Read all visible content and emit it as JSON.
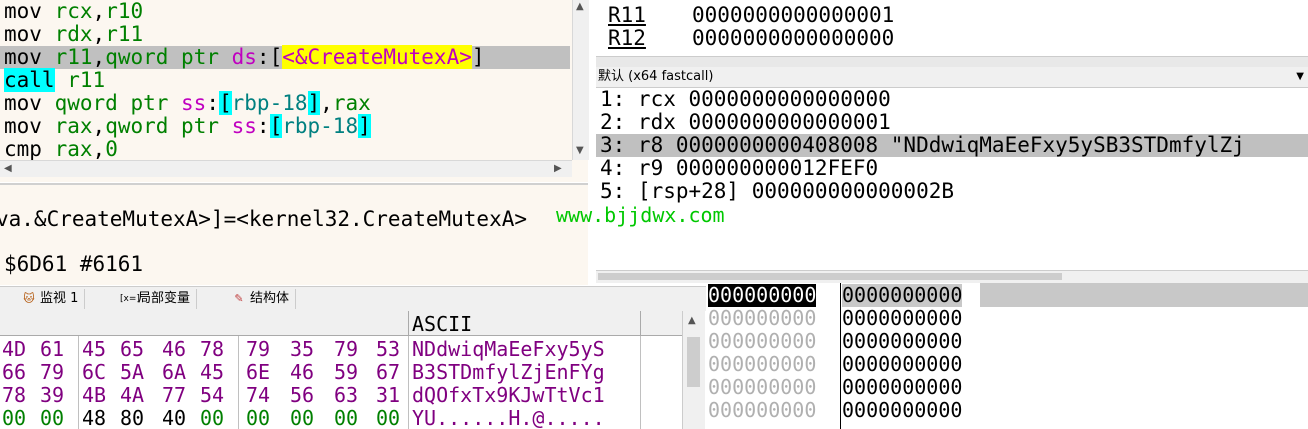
{
  "disassembly": {
    "lines": [
      {
        "op": "mov",
        "args": [
          {
            "t": "reg",
            "v": "rcx"
          },
          {
            "t": "plain",
            "v": ","
          },
          {
            "t": "reg",
            "v": "r10"
          }
        ]
      },
      {
        "op": "mov",
        "args": [
          {
            "t": "reg",
            "v": "rdx"
          },
          {
            "t": "plain",
            "v": ","
          },
          {
            "t": "reg",
            "v": "r11"
          }
        ]
      },
      {
        "op": "mov",
        "selected": true,
        "args": [
          {
            "t": "reg",
            "v": "r11"
          },
          {
            "t": "plain",
            "v": ","
          },
          {
            "t": "reg",
            "v": "qword ptr "
          },
          {
            "t": "seg",
            "v": "ds"
          },
          {
            "t": "plain",
            "v": ":["
          },
          {
            "t": "yellow",
            "v": "<&CreateMutexA>"
          },
          {
            "t": "plain",
            "v": "]"
          }
        ]
      },
      {
        "op": "call",
        "opstyle": "cyan",
        "args": [
          {
            "t": "reg",
            "v": "r11"
          }
        ]
      },
      {
        "op": "mov",
        "args": [
          {
            "t": "reg",
            "v": "qword ptr "
          },
          {
            "t": "seg",
            "v": "ss"
          },
          {
            "t": "plain",
            "v": ":"
          },
          {
            "t": "brk",
            "v": "["
          },
          {
            "t": "mem",
            "v": "rbp-18"
          },
          {
            "t": "brk",
            "v": "]"
          },
          {
            "t": "plain",
            "v": ","
          },
          {
            "t": "reg",
            "v": "rax"
          }
        ]
      },
      {
        "op": "mov",
        "args": [
          {
            "t": "reg",
            "v": "rax"
          },
          {
            "t": "plain",
            "v": ","
          },
          {
            "t": "reg",
            "v": "qword ptr "
          },
          {
            "t": "seg",
            "v": "ss"
          },
          {
            "t": "plain",
            "v": ":"
          },
          {
            "t": "brk",
            "v": "["
          },
          {
            "t": "mem",
            "v": "rbp-18"
          },
          {
            "t": "brk",
            "v": "]"
          }
        ]
      },
      {
        "op": "cmp",
        "args": [
          {
            "t": "reg",
            "v": "rax"
          },
          {
            "t": "plain",
            "v": ","
          },
          {
            "t": "reg",
            "v": "0"
          }
        ]
      }
    ]
  },
  "info": {
    "line1": "va.&CreateMutexA>]=<kernel32.CreateMutexA>",
    "line2": "$6D61 #6161"
  },
  "registers": [
    {
      "name": "R11",
      "value": "0000000000000001"
    },
    {
      "name": "R12",
      "value": "0000000000000000"
    }
  ],
  "call_args": {
    "header": "默认 (x64 fastcall)",
    "lines": [
      "1: rcx 0000000000000000",
      "2: rdx 0000000000000001",
      "3: r8 0000000000408008 \"NDdwiqMaEeFxy5ySB3STDmfylZj",
      "4: r9 000000000012FEF0",
      "5: [rsp+28] 000000000000002B"
    ],
    "selected_index": 2
  },
  "watermark": "www.bjjdwx.com",
  "tabs": [
    {
      "icon": "monitor-icon",
      "label": "监视 1"
    },
    {
      "icon": "locals-icon",
      "label": "局部变量"
    },
    {
      "icon": "struct-icon",
      "label": "结构体"
    }
  ],
  "dump": {
    "ascii_header": "ASCII",
    "rows": [
      {
        "hex": [
          "4D",
          "61",
          "45",
          "65",
          "46",
          "78",
          "79",
          "35",
          "79",
          "53"
        ],
        "ascii": "NDdwiqMaEeFxy5yS"
      },
      {
        "hex": [
          "66",
          "79",
          "6C",
          "5A",
          "6A",
          "45",
          "6E",
          "46",
          "59",
          "67"
        ],
        "ascii": "B3STDmfylZjEnFYg"
      },
      {
        "hex": [
          "78",
          "39",
          "4B",
          "4A",
          "77",
          "54",
          "74",
          "56",
          "63",
          "31"
        ],
        "ascii": "dQOfxTx9KJwTtVc1"
      },
      {
        "hex": [
          "00",
          "00",
          "48",
          "80",
          "40",
          "00",
          "00",
          "00",
          "00",
          "00"
        ],
        "ascii": "YU......H.@....."
      }
    ]
  },
  "stack": {
    "rows": [
      {
        "addr": "000000000",
        "val": "0000000000"
      },
      {
        "addr": "000000000",
        "val": "0000000000"
      },
      {
        "addr": "000000000",
        "val": "0000000000"
      },
      {
        "addr": "000000000",
        "val": "0000000000"
      },
      {
        "addr": "000000000",
        "val": "0000000000"
      },
      {
        "addr": "000000000",
        "val": "0000000000"
      }
    ]
  }
}
